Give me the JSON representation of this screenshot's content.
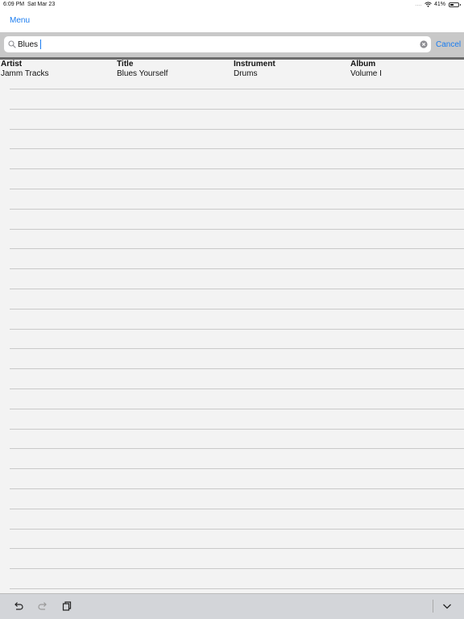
{
  "status": {
    "time": "6:09 PM",
    "date": "Sat Mar 23",
    "signal_dots": "....",
    "wifi_icon": "wifi-icon",
    "battery_text": "41%",
    "battery_level": 0.41
  },
  "nav": {
    "menu_label": "Menu"
  },
  "search": {
    "value": "Blues",
    "cancel_label": "Cancel",
    "search_icon": "magnifier-icon",
    "clear_icon": "clear-x-icon"
  },
  "table": {
    "headers": [
      "Artist",
      "Title",
      "Instrument",
      "Album"
    ],
    "rows": [
      [
        "Jamm Tracks",
        "Blues Yourself",
        "Drums",
        "Volume I"
      ]
    ]
  },
  "toolbar": {
    "buttons": [
      "undo-icon",
      "redo-icon",
      "paste-icon",
      "chevron-down-icon"
    ]
  },
  "colors": {
    "accent": "#1a7cf0",
    "background": "#f3f3f3",
    "search_bar": "#c8c8c8",
    "toolbar": "#d3d5d9"
  }
}
